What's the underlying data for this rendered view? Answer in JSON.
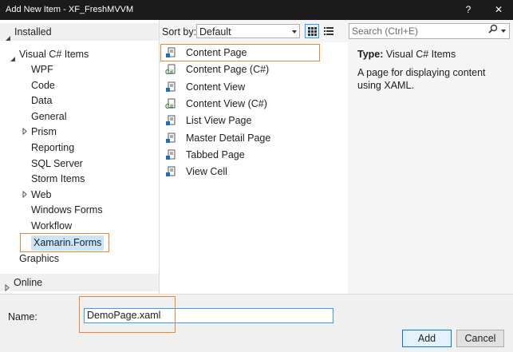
{
  "window": {
    "title": "Add New Item - XF_FreshMVVM",
    "help_glyph": "?",
    "close_glyph": "✕"
  },
  "tree": {
    "installed": "Installed",
    "group": "Visual C# Items",
    "items": [
      {
        "label": "WPF",
        "expandable": false
      },
      {
        "label": "Code",
        "expandable": false
      },
      {
        "label": "Data",
        "expandable": false
      },
      {
        "label": "General",
        "expandable": false
      },
      {
        "label": "Prism",
        "expandable": true
      },
      {
        "label": "Reporting",
        "expandable": false
      },
      {
        "label": "SQL Server",
        "expandable": false
      },
      {
        "label": "Storm Items",
        "expandable": false
      },
      {
        "label": "Web",
        "expandable": true
      },
      {
        "label": "Windows Forms",
        "expandable": false
      },
      {
        "label": "Workflow",
        "expandable": false
      },
      {
        "label": "Xamarin.Forms",
        "expandable": false,
        "selected": true
      }
    ],
    "graphics": "Graphics",
    "online": "Online"
  },
  "toolbar": {
    "sort_label": "Sort by:",
    "sort_value": "Default",
    "search_placeholder": "Search (Ctrl+E)",
    "search_icon": "search-icon"
  },
  "templates": [
    {
      "label": "Content Page",
      "icon": "xaml-page-icon",
      "selected": true
    },
    {
      "label": "Content Page (C#)",
      "icon": "csharp-page-icon"
    },
    {
      "label": "Content View",
      "icon": "xaml-page-icon"
    },
    {
      "label": "Content View (C#)",
      "icon": "csharp-page-icon"
    },
    {
      "label": "List View Page",
      "icon": "xaml-page-icon"
    },
    {
      "label": "Master Detail Page",
      "icon": "xaml-page-icon"
    },
    {
      "label": "Tabbed Page",
      "icon": "xaml-page-icon"
    },
    {
      "label": "View Cell",
      "icon": "xaml-page-icon"
    }
  ],
  "details": {
    "type_label": "Type:",
    "type_value": "Visual C# Items",
    "description": "A page for displaying content using XAML."
  },
  "bottom": {
    "name_label": "Name:",
    "name_value": "DemoPage.xaml",
    "add_label": "Add",
    "cancel_label": "Cancel"
  },
  "colors": {
    "titlebar": "#1b1b1c",
    "highlight_orange": "#f0832b",
    "selection_blue": "#cce4f7",
    "focus_blue": "#3399ff"
  }
}
